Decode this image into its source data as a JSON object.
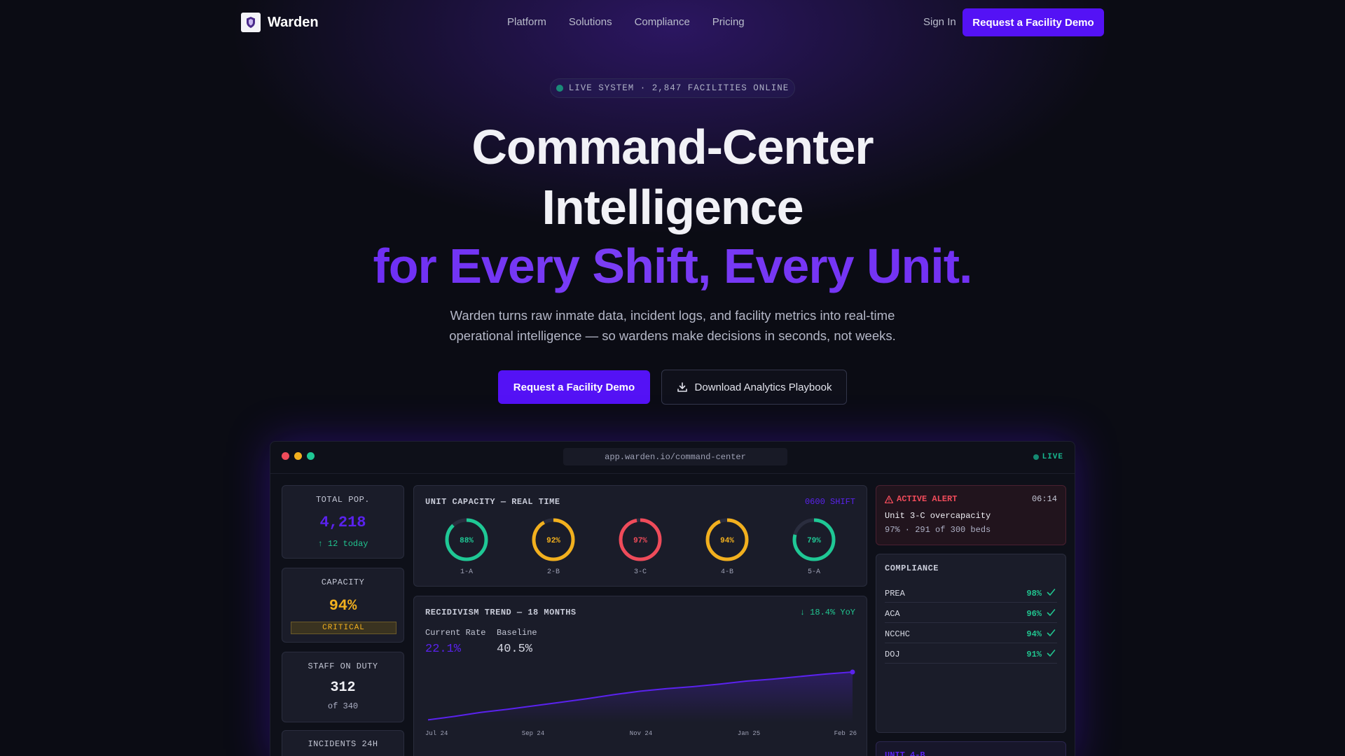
{
  "brand": {
    "name": "Warden"
  },
  "nav": {
    "links": [
      "Platform",
      "Solutions",
      "Compliance",
      "Pricing"
    ],
    "sign_in": "Sign In",
    "cta": "Request a Facility Demo"
  },
  "hero": {
    "badge": "LIVE SYSTEM · 2,847 FACILITIES ONLINE",
    "title_line1": "Command-Center",
    "title_line2": "Intelligence",
    "title_line3": "for Every Shift, Every Unit.",
    "subtitle_line1": "Warden turns raw inmate data, incident logs, and facility metrics into real-time",
    "subtitle_line2": "operational intelligence — so wardens make decisions in seconds, not weeks.",
    "primary_cta": "Request a Facility Demo",
    "secondary_cta": "Download Analytics Playbook"
  },
  "app": {
    "url": "app.warden.io/command-center",
    "live": "LIVE",
    "stats": {
      "total_pop": {
        "label": "TOTAL POP.",
        "value": "4,218",
        "note": "↑ 12 today"
      },
      "capacity": {
        "label": "CAPACITY",
        "value": "94%",
        "note": "CRITICAL"
      },
      "staff": {
        "label": "STAFF ON DUTY",
        "value": "312",
        "note": "of 340"
      },
      "incidents": {
        "label": "INCIDENTS 24H"
      }
    },
    "unit_capacity": {
      "title": "UNIT CAPACITY — REAL TIME",
      "shift": "0600 SHIFT",
      "units": [
        {
          "name": "1-A",
          "pct": 88,
          "label": "88%",
          "color": "#1fc895"
        },
        {
          "name": "2-B",
          "pct": 92,
          "label": "92%",
          "color": "#f2b01e"
        },
        {
          "name": "3-C",
          "pct": 97,
          "label": "97%",
          "color": "#ef4b5a"
        },
        {
          "name": "4-B",
          "pct": 94,
          "label": "94%",
          "color": "#f2b01e"
        },
        {
          "name": "5-A",
          "pct": 79,
          "label": "79%",
          "color": "#1fc895"
        }
      ]
    },
    "recidivism": {
      "title": "RECIDIVISM TREND — 18 MONTHS",
      "yoy": "↓ 18.4% YoY",
      "current_label": "Current Rate",
      "current_value": "22.1%",
      "baseline_label": "Baseline",
      "baseline_value": "40.5%"
    },
    "alert": {
      "title": "ACTIVE ALERT",
      "time": "06:14",
      "headline": "Unit 3-C overcapacity",
      "detail": "97% · 291 of 300 beds"
    },
    "compliance": {
      "title": "COMPLIANCE",
      "rows": [
        {
          "name": "PREA",
          "value": "98%"
        },
        {
          "name": "ACA",
          "value": "96%"
        },
        {
          "name": "NCCHC",
          "value": "94%"
        },
        {
          "name": "DOJ",
          "value": "91%"
        }
      ]
    },
    "unit_tag": "UNIT 4-B"
  },
  "chart_data": {
    "type": "line",
    "title": "RECIDIVISM TREND — 18 MONTHS",
    "x_tick_labels": [
      "Jul 24",
      "Sep 24",
      "Nov 24",
      "Jan 25",
      "Feb 26"
    ],
    "series": [
      {
        "values": [
          0.05,
          0.12,
          0.2,
          0.26,
          0.33,
          0.4,
          0.47,
          0.55,
          0.62,
          0.67,
          0.71,
          0.76,
          0.82,
          0.86,
          0.91,
          0.96,
          1.0
        ]
      }
    ],
    "ylim": [
      0,
      1
    ],
    "grid": false,
    "colors": {
      "line": "#5a22ee"
    }
  }
}
